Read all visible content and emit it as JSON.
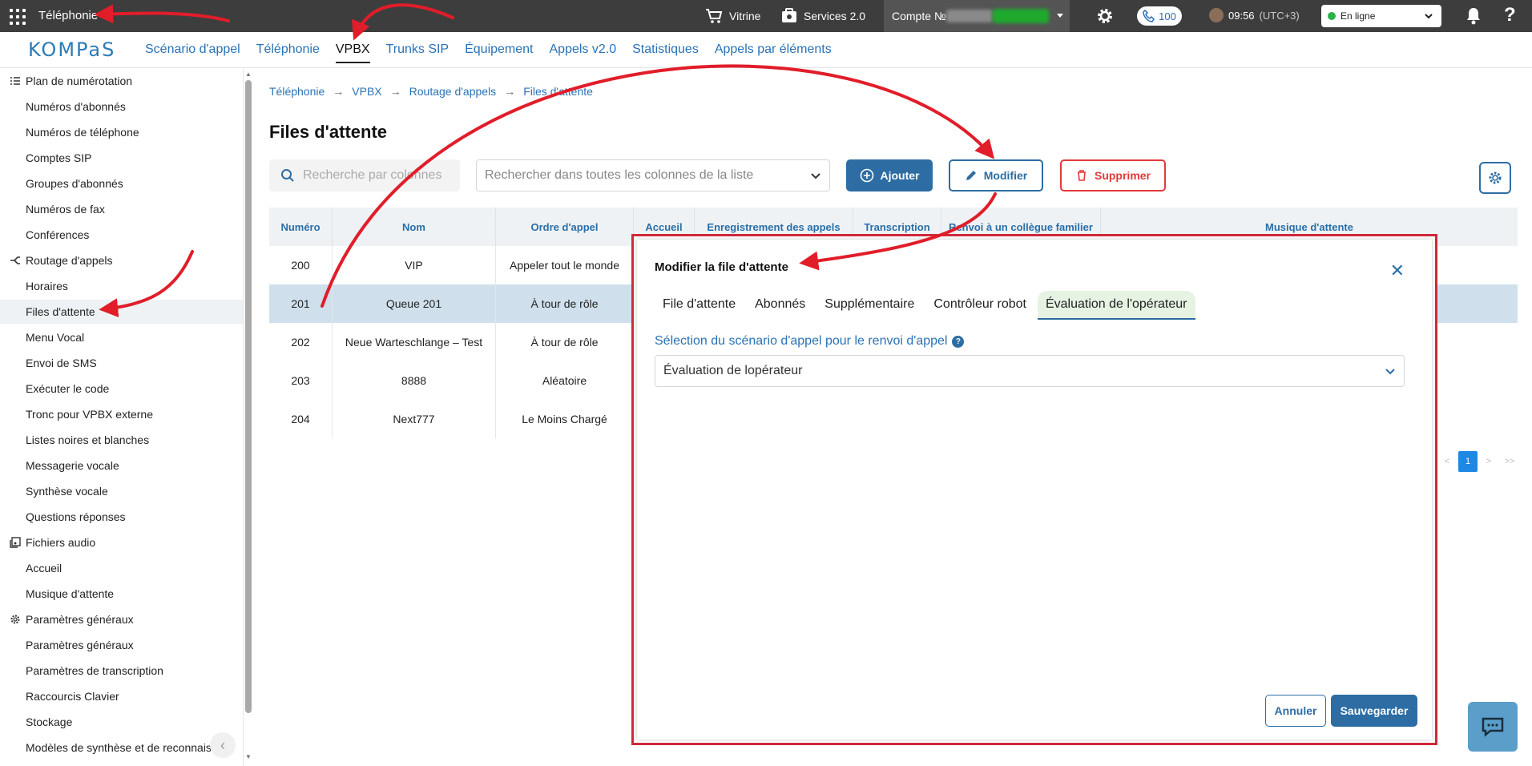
{
  "topbar": {
    "app_title": "Téléphonie",
    "vitrine": "Vitrine",
    "services": "Services 2.0",
    "account_label": "Compte №",
    "calls_count": "100",
    "time": "09:56",
    "timezone": "(UTC+3)",
    "status": "En ligne"
  },
  "nav": {
    "logo": "KOMPaS",
    "links": [
      "Scénario d'appel",
      "Téléphonie",
      "VPBX",
      "Trunks SIP",
      "Équipement",
      "Appels v2.0",
      "Statistiques",
      "Appels par éléments"
    ],
    "active": "VPBX"
  },
  "sidebar": {
    "rows": [
      {
        "type": "group",
        "label": "Plan de numérotation",
        "icon": "list-icon"
      },
      {
        "type": "item",
        "label": "Numéros d'abonnés"
      },
      {
        "type": "item",
        "label": "Numéros de téléphone"
      },
      {
        "type": "item",
        "label": "Comptes SIP"
      },
      {
        "type": "item",
        "label": "Groupes d'abonnés"
      },
      {
        "type": "item",
        "label": "Numéros de fax"
      },
      {
        "type": "item",
        "label": "Conférences"
      },
      {
        "type": "group",
        "label": "Routage d'appels",
        "icon": "routing-icon"
      },
      {
        "type": "item",
        "label": "Horaires"
      },
      {
        "type": "item",
        "label": "Files d'attente",
        "active": true
      },
      {
        "type": "item",
        "label": "Menu Vocal"
      },
      {
        "type": "item",
        "label": "Envoi de SMS"
      },
      {
        "type": "item",
        "label": "Exécuter le code"
      },
      {
        "type": "item",
        "label": "Tronc pour VPBX externe"
      },
      {
        "type": "item",
        "label": "Listes noires et blanches"
      },
      {
        "type": "item",
        "label": "Messagerie vocale"
      },
      {
        "type": "item",
        "label": "Synthèse vocale"
      },
      {
        "type": "item",
        "label": "Questions réponses"
      },
      {
        "type": "group",
        "label": "Fichiers audio",
        "icon": "audio-files-icon"
      },
      {
        "type": "item",
        "label": "Accueil"
      },
      {
        "type": "item",
        "label": "Musique d'attente"
      },
      {
        "type": "group",
        "label": "Paramètres généraux",
        "icon": "gear-icon"
      },
      {
        "type": "item",
        "label": "Paramètres généraux"
      },
      {
        "type": "item",
        "label": "Paramètres de transcription"
      },
      {
        "type": "item",
        "label": "Raccourcis Clavier"
      },
      {
        "type": "item",
        "label": "Stockage"
      },
      {
        "type": "item",
        "label": "Modèles de synthèse et de reconnais"
      }
    ]
  },
  "breadcrumb": [
    "Téléphonie",
    "VPBX",
    "Routage d'appels",
    "Files d'attente"
  ],
  "page_title": "Files d'attente",
  "toolbar": {
    "column_search_placeholder": "Recherche par colonnes",
    "all_search_placeholder": "Rechercher dans toutes les colonnes de la liste",
    "add_label": "Ajouter",
    "edit_label": "Modifier",
    "delete_label": "Supprimer"
  },
  "table": {
    "headers": [
      "Numéro",
      "Nom",
      "Ordre d'appel",
      "Accueil",
      "Enregistrement des appels",
      "Transcription",
      "Renvoi à un collègue familier",
      "Musique d'attente"
    ],
    "rows": [
      [
        "200",
        "VIP",
        "Appeler tout le monde"
      ],
      [
        "201",
        "Queue 201",
        "À tour de rôle"
      ],
      [
        "202",
        "Neue Warteschlange – Test",
        "À tour de rôle"
      ],
      [
        "203",
        "8888",
        "Aléatoire"
      ],
      [
        "204",
        "Next777",
        "Le Moins Chargé"
      ]
    ],
    "selected_row": "201"
  },
  "pager": {
    "prev": "<",
    "current": "1",
    "next": ">",
    "last": ">>"
  },
  "modal": {
    "title": "Modifier la file d'attente",
    "tabs": [
      "File d'attente",
      "Abonnés",
      "Supplémentaire",
      "Contrôleur robot",
      "Évaluation de l'opérateur"
    ],
    "active_tab": "Évaluation de l'opérateur",
    "field_label": "Sélection du scénario d'appel pour le renvoi d'appel",
    "help": "?",
    "field_value": "Évaluation de lopérateur",
    "cancel_label": "Annuler",
    "save_label": "Sauvegarder"
  },
  "colors": {
    "accent": "#2d6da3",
    "danger": "#e23a3a",
    "annotation": "#d0283a",
    "online": "#2ab24a"
  }
}
